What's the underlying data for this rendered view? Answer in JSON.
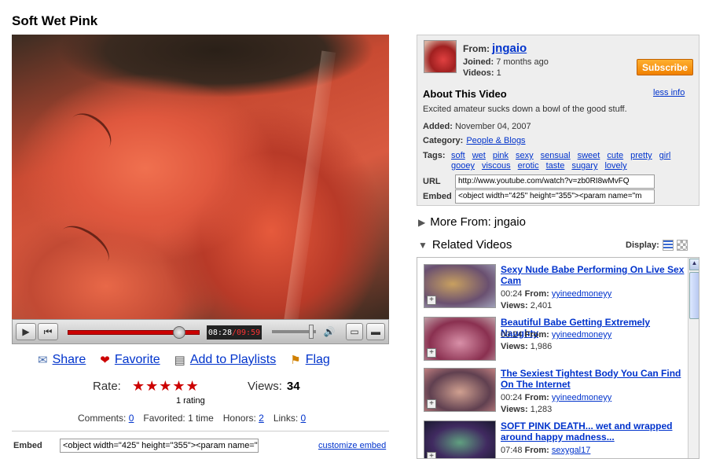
{
  "title": "Soft Wet Pink",
  "player": {
    "current": "08:28",
    "sep": " / ",
    "total": "09:59"
  },
  "actions": {
    "share": "Share",
    "favorite": "Favorite",
    "playlists": "Add to Playlists",
    "flag": "Flag"
  },
  "rating": {
    "label": "Rate:",
    "stars": "★★★★★",
    "count": "1 rating"
  },
  "views": {
    "label": "Views:",
    "value": "34"
  },
  "stats": {
    "comments_label": "Comments:",
    "comments": "0",
    "favorited": "Favorited: 1 time",
    "honors_label": "Honors:",
    "honors": "2",
    "links_label": "Links:",
    "links": "0"
  },
  "embed_bottom": {
    "label": "Embed",
    "value": "<object width=\"425\" height=\"355\"><param name=\"m",
    "customize": "customize embed"
  },
  "info": {
    "from_label": "From:",
    "user": "jngaio",
    "joined_label": "Joined:",
    "joined": "7 months ago",
    "videos_label": "Videos:",
    "videos": "1",
    "subscribe": "Subscribe",
    "about": "About This Video",
    "less_info": "less info",
    "description": "Excited amateur sucks down a bowl of the good stuff.",
    "added_label": "Added:",
    "added": "November 04, 2007",
    "category_label": "Category:",
    "category": "People & Blogs",
    "tags_label": "Tags:",
    "tags": [
      "soft",
      "wet",
      "pink",
      "sexy",
      "sensual",
      "sweet",
      "cute",
      "pretty",
      "girl",
      "gooey",
      "viscous",
      "erotic",
      "taste",
      "sugary",
      "lovely"
    ],
    "url_label": "URL",
    "url": "http://www.youtube.com/watch?v=zb0RI8wMvFQ",
    "embed_label": "Embed",
    "embed": "<object width=\"425\" height=\"355\"><param name=\"m"
  },
  "more_from": "More From: jngaio",
  "related_title": "Related Videos",
  "display_label": "Display:",
  "related": [
    {
      "title": "Sexy Nude Babe Performing On Live Sex Cam",
      "time": "00:24",
      "from_label": "From:",
      "user": "yyineedmoneyy",
      "views_label": "Views:",
      "views": "2,401"
    },
    {
      "title": "Beautiful Babe Getting Extremely Naughty",
      "time": "00:24",
      "from_label": "From:",
      "user": "yyineedmoneyy",
      "views_label": "Views:",
      "views": "1,986"
    },
    {
      "title": "The Sexiest Tightest Body You Can Find On The Internet",
      "time": "00:24",
      "from_label": "From:",
      "user": "yyineedmoneyy",
      "views_label": "Views:",
      "views": "1,283"
    },
    {
      "title": "SOFT PINK DEATH... wet and wrapped around happy madness...",
      "time": "07:48",
      "from_label": "From:",
      "user": "sexygal17"
    }
  ],
  "colors": {
    "link": "#0033cc",
    "subscribe": "#f08000",
    "progress": "#cc0000",
    "panel": "#eeeeee"
  }
}
